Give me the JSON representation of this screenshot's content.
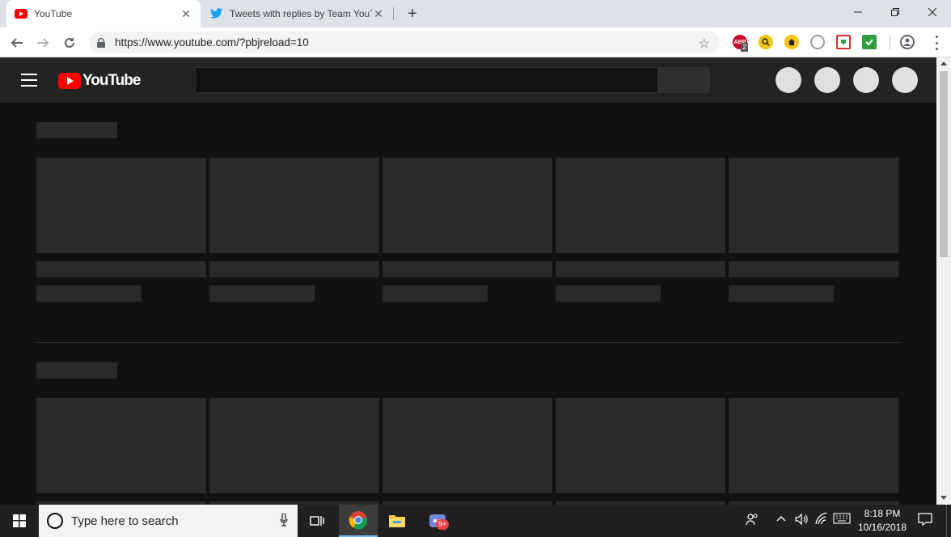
{
  "browser": {
    "tabs": [
      {
        "title": "YouTube",
        "active": true
      },
      {
        "title": "Tweets with replies by Team YouT",
        "active": false
      }
    ],
    "url": "https://www.youtube.com/?pbjreload=10",
    "extensions": [
      {
        "name": "adblock-icon",
        "badge": "ABP",
        "count": "2",
        "color": "#c70d2c"
      },
      {
        "name": "magnifier-extension-icon",
        "color": "#f1c40f"
      },
      {
        "name": "home-extension-icon",
        "color": "#f5c518"
      },
      {
        "name": "headphones-extension-icon",
        "color": "#9e9e9e"
      },
      {
        "name": "shield-extension-icon",
        "color": "#d32f2f"
      },
      {
        "name": "check-extension-icon",
        "color": "#2e9e3f"
      }
    ]
  },
  "youtube": {
    "logo_text": "YouTube",
    "brand_color": "#ff0000"
  },
  "taskbar": {
    "search_placeholder": "Type here to search",
    "time": "8:18 PM",
    "date": "10/16/2018",
    "discord_badge": "9+"
  }
}
